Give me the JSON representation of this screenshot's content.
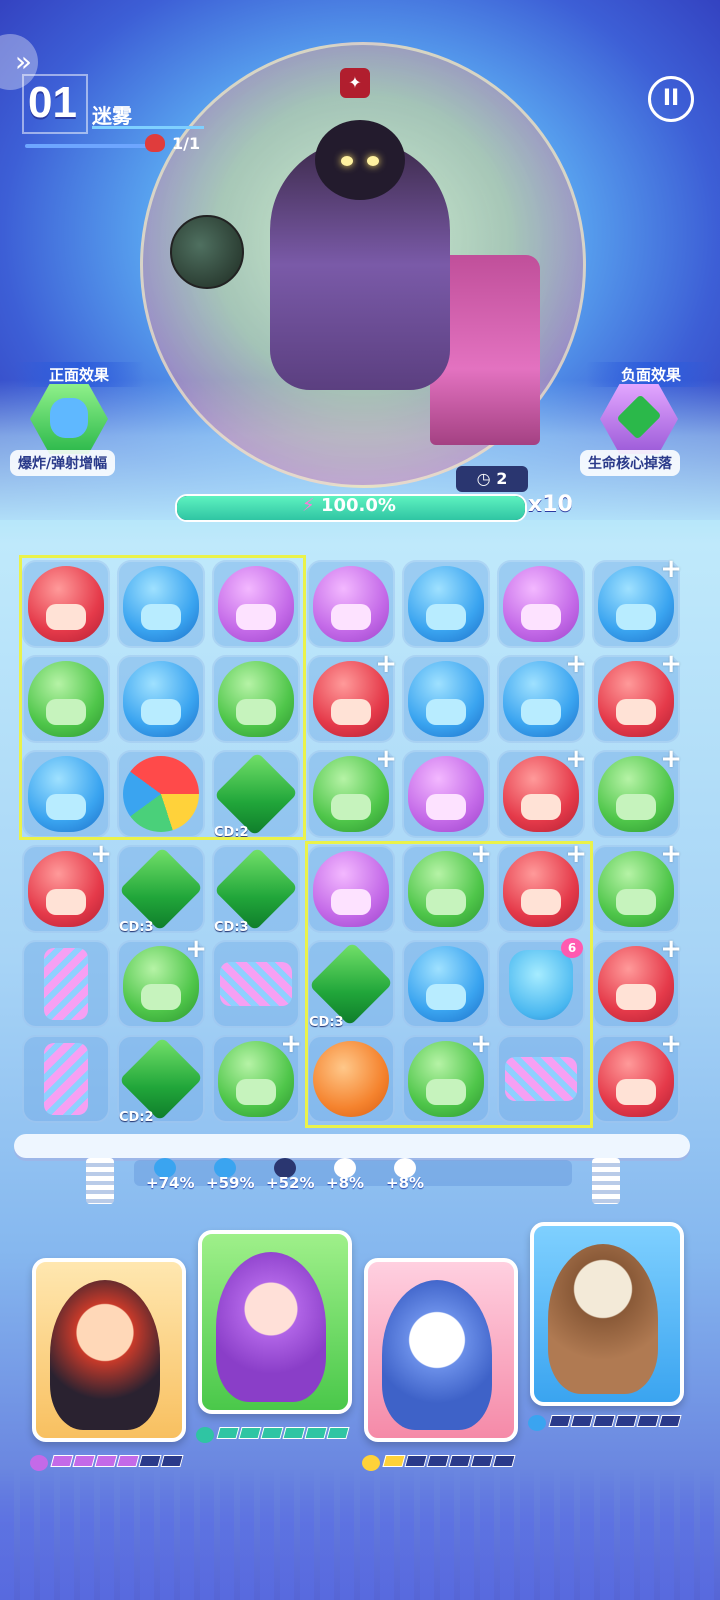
{
  "header": {
    "level_number": "01",
    "level_name": "迷雾",
    "boss_count": "1/1",
    "pause_icon": "pause-icon",
    "nav_icon": "chevron-right-icon"
  },
  "effects": {
    "positive_title": "正面效果",
    "positive_desc": "爆炸/弹射增幅",
    "negative_title": "负面效果",
    "negative_desc": "生命核心掉落"
  },
  "boss": {
    "timer": "2",
    "energy_percent": 100.0,
    "energy_label": "100.0%",
    "multiplier": "x10"
  },
  "board": {
    "rows": [
      [
        {
          "t": "red"
        },
        {
          "t": "blue"
        },
        {
          "t": "purple"
        },
        {
          "t": "purple"
        },
        {
          "t": "blue"
        },
        {
          "t": "purple"
        },
        {
          "t": "blue",
          "plus": true
        }
      ],
      [
        {
          "t": "green"
        },
        {
          "t": "blue"
        },
        {
          "t": "green"
        },
        {
          "t": "red",
          "plus": true
        },
        {
          "t": "blue"
        },
        {
          "t": "blue",
          "plus": true
        },
        {
          "t": "red",
          "plus": true
        }
      ],
      [
        {
          "t": "blue"
        },
        {
          "t": "ball"
        },
        {
          "t": "leaf",
          "cd": "CD:2"
        },
        {
          "t": "green",
          "plus": true
        },
        {
          "t": "purple"
        },
        {
          "t": "red",
          "plus": true
        },
        {
          "t": "green",
          "plus": true
        }
      ],
      [
        {
          "t": "red",
          "plus": true
        },
        {
          "t": "leaf",
          "cd": "CD:3"
        },
        {
          "t": "leaf",
          "cd": "CD:3"
        },
        {
          "t": "purple"
        },
        {
          "t": "green",
          "plus": true
        },
        {
          "t": "red",
          "plus": true
        },
        {
          "t": "green",
          "plus": true
        }
      ],
      [
        {
          "t": "spring-v"
        },
        {
          "t": "green",
          "plus": true
        },
        {
          "t": "spring-h"
        },
        {
          "t": "leaf",
          "cd": "CD:3"
        },
        {
          "t": "blue"
        },
        {
          "t": "shield",
          "badge": "6"
        },
        {
          "t": "red",
          "plus": true
        }
      ],
      [
        {
          "t": "spring-v"
        },
        {
          "t": "leaf",
          "cd": "CD:2"
        },
        {
          "t": "green",
          "plus": true
        },
        {
          "t": "bomb"
        },
        {
          "t": "green",
          "plus": true
        },
        {
          "t": "spring-h"
        },
        {
          "t": "red",
          "plus": true
        }
      ]
    ]
  },
  "buffs": [
    {
      "value": "+74%",
      "color": "#3aa4f0"
    },
    {
      "value": "+59%",
      "color": "#3aa4f0"
    },
    {
      "value": "+52%",
      "color": "#2a3670"
    },
    {
      "value": "+8%",
      "color": "#ffffff"
    },
    {
      "value": "+8%",
      "color": "#ffffff"
    }
  ],
  "characters": [
    {
      "name": "opera-warrior",
      "energy_color": "#c46ae8",
      "filled": 4,
      "total": 6
    },
    {
      "name": "purple-maid",
      "energy_color": "#2fc5a3",
      "filled": 6,
      "total": 6
    },
    {
      "name": "husky-pilot",
      "energy_color": "#ffd23a",
      "filled": 1,
      "total": 6
    },
    {
      "name": "skull-girl",
      "energy_color": "#3aa4f0",
      "filled": 0,
      "total": 6
    }
  ],
  "colors": {
    "accent": "#eaf24a",
    "energy": "#2fc5a3",
    "panel": "#2a3670"
  }
}
